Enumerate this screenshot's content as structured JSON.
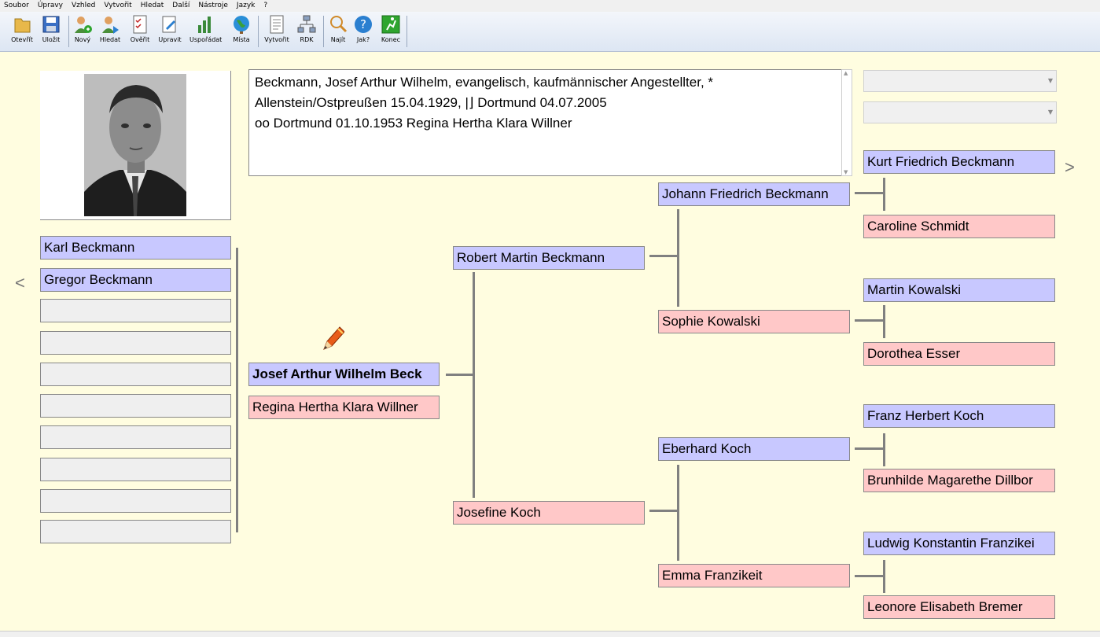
{
  "menu": [
    "Soubor",
    "Úpravy",
    "Vzhled",
    "Vytvořit",
    "Hledat",
    "Další",
    "Nástroje",
    "Jazyk",
    "?"
  ],
  "toolbar": {
    "buttons": [
      {
        "label": "Otevřít",
        "icon": "folder-open-icon"
      },
      {
        "label": "Uložit",
        "icon": "save-disk-icon"
      },
      {
        "label": "Nový",
        "icon": "new-person-icon"
      },
      {
        "label": "Hledat",
        "icon": "find-person-icon"
      },
      {
        "label": "Ověřit",
        "icon": "verify-checklist-icon"
      },
      {
        "label": "Upravit",
        "icon": "edit-icon"
      },
      {
        "label": "Uspořádat",
        "icon": "arrange-icon"
      },
      {
        "label": "Místa",
        "icon": "globe-icon"
      },
      {
        "label": "Vytvořit",
        "icon": "create-document-icon"
      },
      {
        "label": "RDK",
        "icon": "tree-chart-icon"
      },
      {
        "label": "Najít",
        "icon": "magnifier-icon"
      },
      {
        "label": "Jak?",
        "icon": "help-icon"
      },
      {
        "label": "Konec",
        "icon": "exit-icon"
      }
    ]
  },
  "info": {
    "lines": [
      "Beckmann, Josef Arthur Wilhelm, evangelisch, kaufmännischer Angestellter, *",
      "Allenstein/Ostpreußen 15.04.1929, |⌋ Dortmund 04.07.2005",
      "oo Dortmund 01.10.1953 Regina Hertha Klara Willner"
    ]
  },
  "nav": {
    "prev": "<",
    "next": ">"
  },
  "children": [
    "Karl Beckmann",
    "Gregor Beckmann",
    "",
    "",
    "",
    "",
    "",
    "",
    "",
    ""
  ],
  "proband": {
    "name": "Josef Arthur Wilhelm Beck",
    "spouse": "Regina Hertha Klara Willner"
  },
  "parents": {
    "father": "Robert Martin Beckmann",
    "mother": "Josefine Koch"
  },
  "grandparents": {
    "ff": "Johann Friedrich Beckmann",
    "fm": "Sophie Kowalski",
    "mf": "Eberhard Koch",
    "mm": "Emma Franzikeit"
  },
  "great_grandparents": [
    "Kurt Friedrich Beckmann",
    "Caroline Schmidt",
    "Martin Kowalski",
    "Dorothea Esser",
    "Franz Herbert Koch",
    "Brunhilde Magarethe Dillbor",
    "Ludwig Konstantin Franzikei",
    "Leonore Elisabeth Bremer"
  ],
  "colors": {
    "male": "#c8c8ff",
    "female": "#ffc8c8",
    "empty": "#efefef",
    "background": "#fffde0"
  }
}
